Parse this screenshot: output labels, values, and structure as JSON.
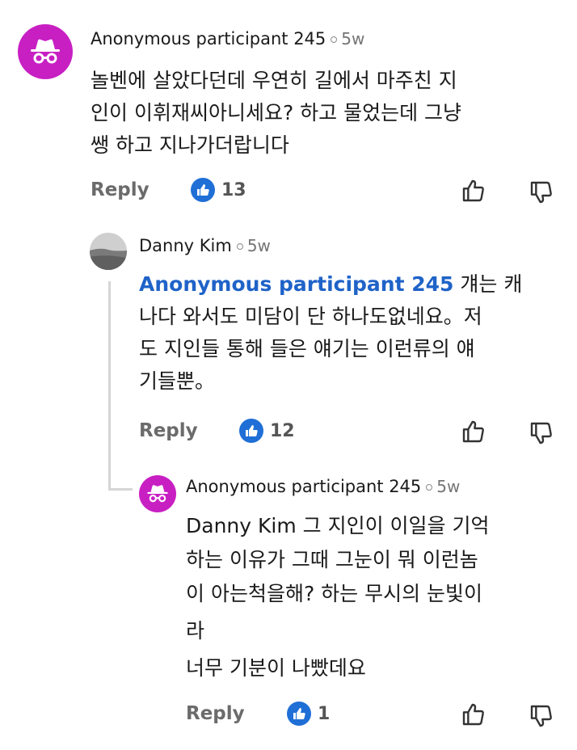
{
  "comments": [
    {
      "author": "Anonymous participant 245",
      "time": "5w",
      "lines": [
        "놀벤에 살았다던데 우연히 길에서 마주친 지",
        "인이 이휘재씨아니세요? 하고 물었는데 그냥",
        "쌩 하고 지나가더랍니다"
      ],
      "reply_label": "Reply",
      "likes": "13"
    },
    {
      "author": "Danny Kim",
      "time": "5w",
      "mention": "Anonymous participant 245",
      "first_line_rest": " 걔는 캐",
      "lines": [
        "나다 와서도 미담이 단 하나도없네요。저",
        "도 지인들 통해 들은 얘기는 이런류의 얘",
        "기들뿐。"
      ],
      "reply_label": "Reply",
      "likes": "12"
    },
    {
      "author": "Anonymous participant 245",
      "time": "5w",
      "lines": [
        "Danny Kim 그 지인이 이일을 기억",
        "하는 이유가 그때 그눈이 뭐 이런놈",
        "이 아는척을해? 하는 무시의 눈빛이",
        "라",
        "너무 기분이 나빴데요"
      ],
      "reply_label": "Reply",
      "likes": "1"
    }
  ],
  "icons": {
    "avatar_anon": "incognito-icon",
    "like": "thumbs-up-icon",
    "dislike": "thumbs-down-icon"
  },
  "colors": {
    "anon_avatar": "#c81fc3",
    "mention": "#1f63c8",
    "like_badge": "#1f6fd6"
  }
}
